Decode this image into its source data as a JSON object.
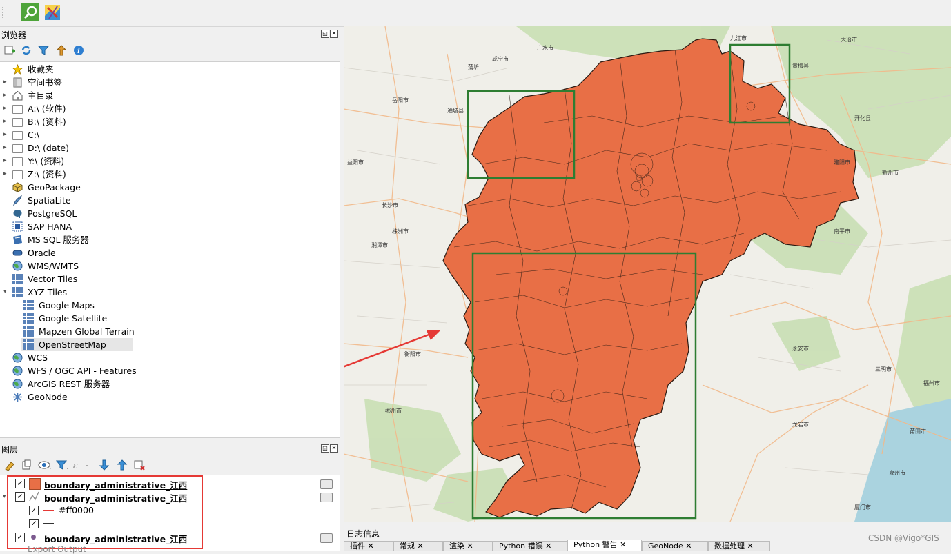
{
  "browser_panel": {
    "title": "浏览器",
    "items": [
      {
        "label": "收藏夹",
        "icon": "star-icon",
        "expandable": false
      },
      {
        "label": "空间书签",
        "icon": "bookmark-icon",
        "expandable": true
      },
      {
        "label": "主目录",
        "icon": "home-icon",
        "expandable": true
      },
      {
        "label": "A:\\ (软件)",
        "icon": "folder-icon",
        "expandable": true
      },
      {
        "label": "B:\\ (资料)",
        "icon": "folder-icon",
        "expandable": true
      },
      {
        "label": "C:\\",
        "icon": "folder-icon",
        "expandable": true
      },
      {
        "label": "D:\\ (date)",
        "icon": "folder-icon",
        "expandable": true
      },
      {
        "label": "Y:\\ (资料)",
        "icon": "folder-icon",
        "expandable": true
      },
      {
        "label": "Z:\\ (资料)",
        "icon": "folder-icon",
        "expandable": true
      },
      {
        "label": "GeoPackage",
        "icon": "geopackage-icon",
        "expandable": false
      },
      {
        "label": "SpatiaLite",
        "icon": "feather-icon",
        "expandable": false
      },
      {
        "label": "PostgreSQL",
        "icon": "elephant-icon",
        "expandable": false
      },
      {
        "label": "SAP HANA",
        "icon": "sap-hana-icon",
        "expandable": false
      },
      {
        "label": "MS SQL 服务器",
        "icon": "mssql-icon",
        "expandable": false
      },
      {
        "label": "Oracle",
        "icon": "oracle-icon",
        "expandable": false
      },
      {
        "label": "WMS/WMTS",
        "icon": "globe-icon",
        "expandable": false
      },
      {
        "label": "Vector Tiles",
        "icon": "grid-icon",
        "expandable": false
      },
      {
        "label": "XYZ Tiles",
        "icon": "grid-icon",
        "expandable": true,
        "expanded": true
      },
      {
        "label": "Google Maps",
        "icon": "grid-icon",
        "child": true
      },
      {
        "label": "Google Satellite",
        "icon": "grid-icon",
        "child": true
      },
      {
        "label": "Mapzen Global Terrain",
        "icon": "grid-icon",
        "child": true
      },
      {
        "label": "OpenStreetMap",
        "icon": "grid-icon",
        "child": true,
        "selected": true
      },
      {
        "label": "WCS",
        "icon": "globe-icon",
        "expandable": false
      },
      {
        "label": "WFS / OGC API - Features",
        "icon": "globe-icon",
        "expandable": false
      },
      {
        "label": "ArcGIS REST 服务器",
        "icon": "globe-icon",
        "expandable": false
      },
      {
        "label": "GeoNode",
        "icon": "geonode-icon",
        "expandable": false
      }
    ]
  },
  "layers_panel": {
    "title": "图层",
    "layers": [
      {
        "label": "boundary_administrative_江西",
        "symbol": "fill",
        "checked": true
      },
      {
        "label": "boundary_administrative_江西",
        "symbol": "line",
        "checked": true
      },
      {
        "label": "#ff0000",
        "symbol": "red-line",
        "checked": true,
        "sub": true
      },
      {
        "label": "",
        "symbol": "black-line",
        "checked": true,
        "sub": true
      },
      {
        "label": "boundary_administrative_江西",
        "symbol": "point",
        "checked": true
      }
    ],
    "partial_item": "Export Output"
  },
  "log_panel": {
    "title": "日志信息",
    "tabs": [
      "插件",
      "常规",
      "渲染",
      "Python 错误",
      "Python 警告",
      "GeoNode",
      "数据处理"
    ]
  },
  "watermark": "CSDN @Vigo*GIS",
  "colors": {
    "polygon_fill": "#e86f46",
    "polygon_stroke": "#2a1a12",
    "highlight_box": "#2e7d32",
    "arrow": "#e53935",
    "layer_box": "#e53935"
  },
  "map_labels": [
    "岳阳市",
    "长沙市",
    "株洲市",
    "湘潭市",
    "衡阳市",
    "郴州市",
    "益阳市",
    "通城县",
    "咸宁市",
    "蒲圻",
    "九江市",
    "黄梅县",
    "大冶市",
    "广水市",
    "永安市",
    "三明市",
    "南平市",
    "建阳市",
    "龙岩市",
    "福州市",
    "莆田市",
    "泉州市",
    "衢州市",
    "开化县",
    "厦门市"
  ]
}
